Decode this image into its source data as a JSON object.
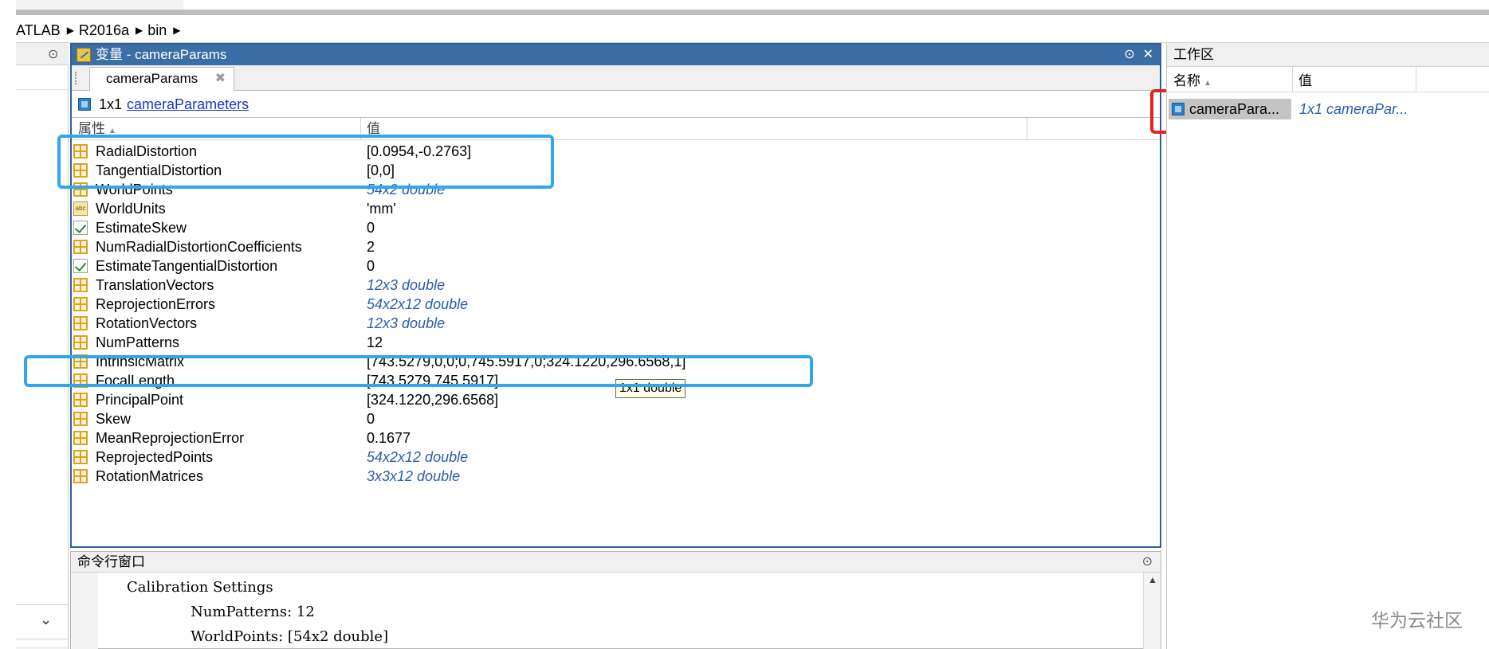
{
  "breadcrumb": {
    "items": [
      "ATLAB",
      "R2016a",
      "bin"
    ]
  },
  "variable_editor": {
    "title": "变量 - cameraParams",
    "tab_label": "cameraParams",
    "size_text": "1x1",
    "class_link": "cameraParameters",
    "col_property": "属性",
    "col_value": "值",
    "properties": [
      {
        "name": "RadialDistortion",
        "value": "[0.0954,-0.2763]",
        "icon": "grid-icon",
        "italic": false
      },
      {
        "name": "TangentialDistortion",
        "value": "[0,0]",
        "icon": "grid-icon",
        "italic": false
      },
      {
        "name": "WorldPoints",
        "value": "54x2 double",
        "icon": "grid-icon",
        "italic": true
      },
      {
        "name": "WorldUnits",
        "value": "'mm'",
        "icon": "abc-icon",
        "italic": false
      },
      {
        "name": "EstimateSkew",
        "value": "0",
        "icon": "checkbox-icon",
        "italic": false
      },
      {
        "name": "NumRadialDistortionCoefficients",
        "value": "2",
        "icon": "grid-icon",
        "italic": false
      },
      {
        "name": "EstimateTangentialDistortion",
        "value": "0",
        "icon": "checkbox-icon",
        "italic": false
      },
      {
        "name": "TranslationVectors",
        "value": "12x3 double",
        "icon": "grid-icon",
        "italic": true
      },
      {
        "name": "ReprojectionErrors",
        "value": "54x2x12 double",
        "icon": "grid-icon",
        "italic": true
      },
      {
        "name": "RotationVectors",
        "value": "12x3 double",
        "icon": "grid-icon",
        "italic": true
      },
      {
        "name": "NumPatterns",
        "value": "12",
        "icon": "grid-icon",
        "italic": false
      },
      {
        "name": "IntrinsicMatrix",
        "value": "[743.5279,0,0;0,745.5917,0;324.1220,296.6568,1]",
        "icon": "grid-icon",
        "italic": false
      },
      {
        "name": "FocalLength",
        "value": "[743.5279,745.5917]",
        "icon": "grid-icon",
        "italic": false
      },
      {
        "name": "PrincipalPoint",
        "value": "[324.1220,296.6568]",
        "icon": "grid-icon",
        "italic": false
      },
      {
        "name": "Skew",
        "value": "0",
        "icon": "grid-icon",
        "italic": false
      },
      {
        "name": "MeanReprojectionError",
        "value": "0.1677",
        "icon": "grid-icon",
        "italic": false
      },
      {
        "name": "ReprojectedPoints",
        "value": "54x2x12 double",
        "icon": "grid-icon",
        "italic": true
      },
      {
        "name": "RotationMatrices",
        "value": "3x3x12 double",
        "icon": "grid-icon",
        "italic": true
      }
    ],
    "tooltip": "1x1 double"
  },
  "command_window": {
    "title": "命令行窗口",
    "lines": [
      "Calibration Settings",
      "              NumPatterns: 12",
      "              WorldPoints: [54x2 double]"
    ]
  },
  "workspace": {
    "title": "工作区",
    "col_name": "名称",
    "col_value": "值",
    "variable_name": "cameraPara...",
    "variable_value": "1x1 cameraPar..."
  },
  "watermark": "华为云社区",
  "colors": {
    "highlight_blue": "#2ea6f0",
    "highlight_red": "#e52420",
    "titlebar": "#3a6ea5"
  }
}
